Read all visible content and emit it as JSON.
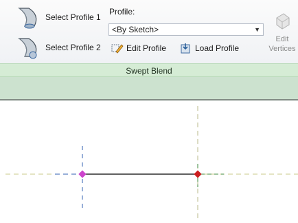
{
  "ribbon": {
    "select_profile_1": "Select Profile 1",
    "select_profile_2": "Select Profile 2",
    "profile_label": "Profile:",
    "profile_value": "<By Sketch>",
    "edit_profile": "Edit Profile",
    "load_profile": "Load Profile",
    "edit_vertices_line1": "Edit",
    "edit_vertices_line2": "Vertices",
    "panel_title": "Swept Blend"
  },
  "colors": {
    "panel_green": "#d5ecd5",
    "options_green": "#cce2cf",
    "endpoint_start": "#cc44cc",
    "endpoint_end": "#cc1f1f",
    "axis_blue": "#2f5fb0",
    "axis_green": "#3c8a3c"
  },
  "icons": {
    "select_profile_1": "swept-profile-icon",
    "select_profile_2": "swept-profile-icon",
    "edit_profile": "edit-profile-icon",
    "load_profile": "load-profile-icon",
    "edit_vertices": "edit-vertices-icon"
  }
}
